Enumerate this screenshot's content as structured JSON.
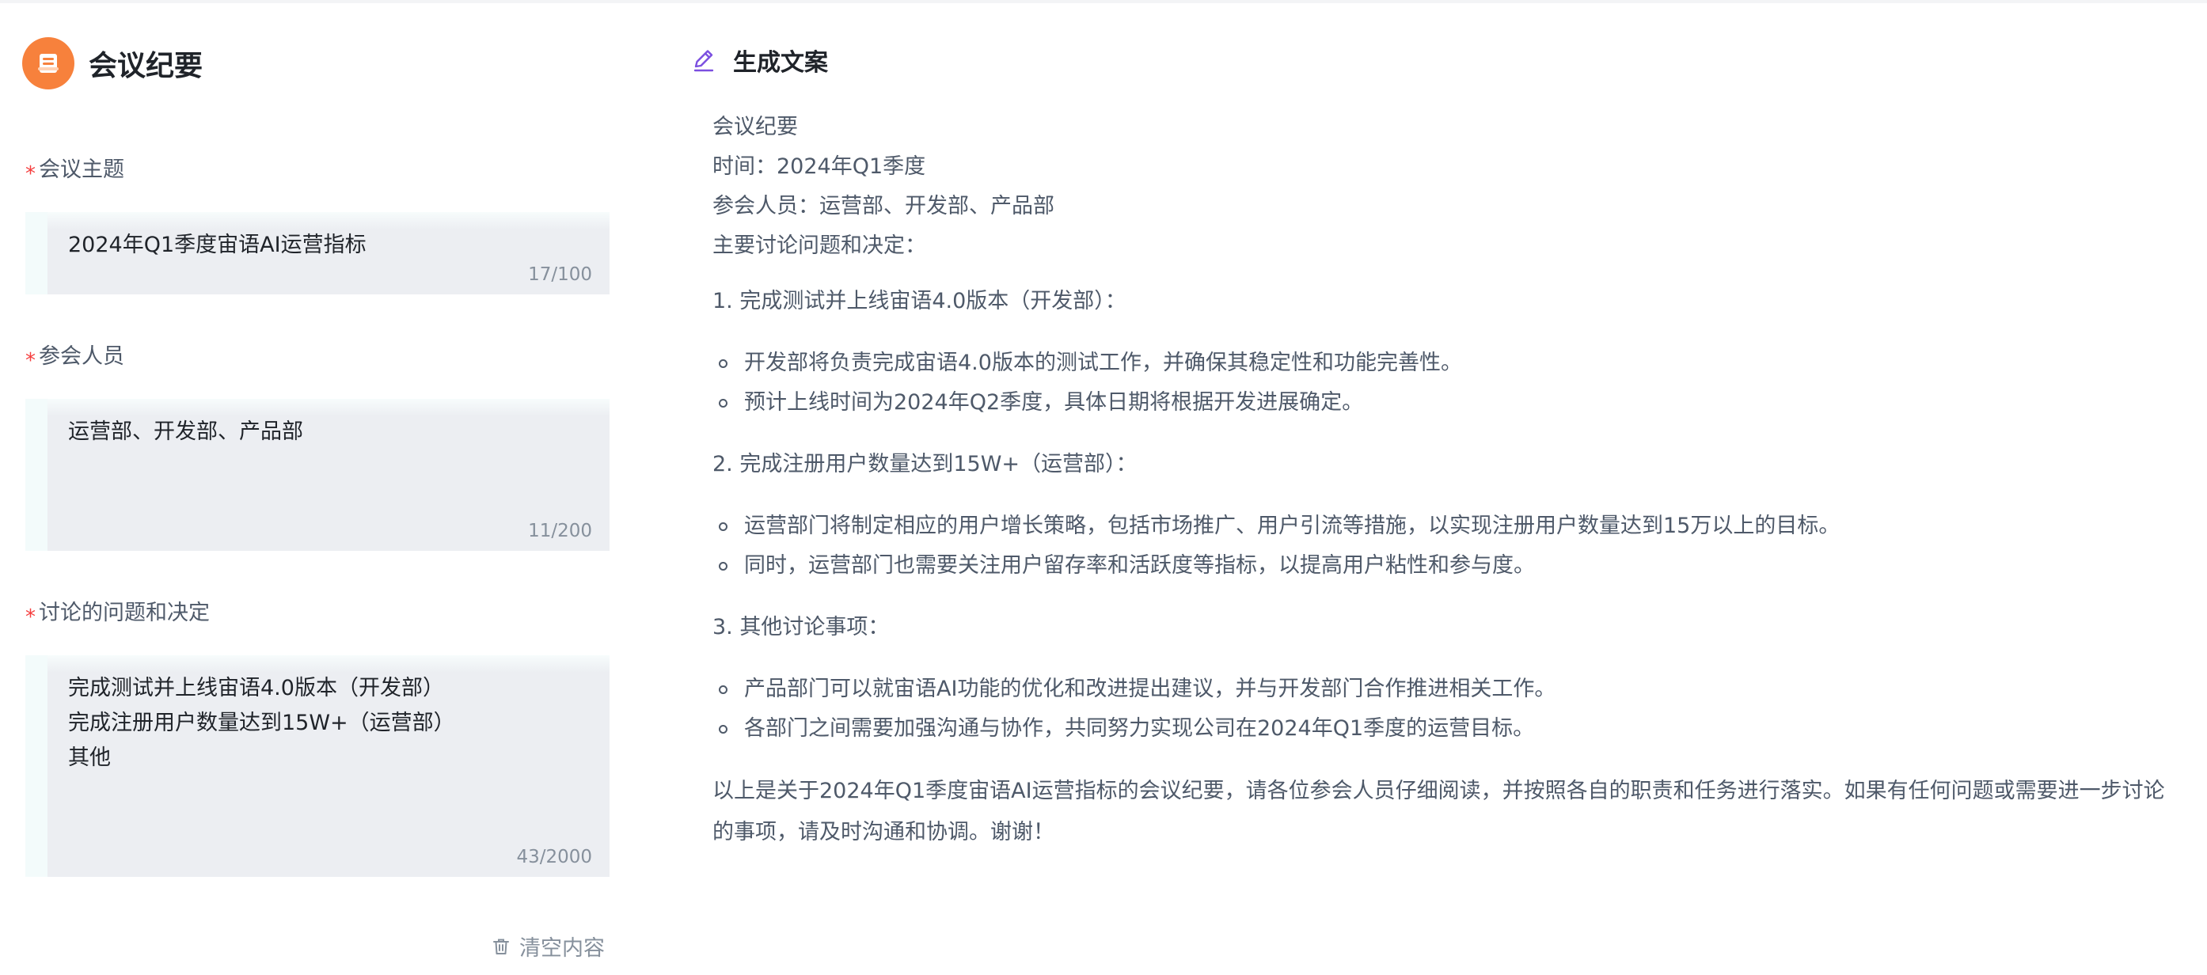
{
  "app": {
    "title": "会议纪要",
    "logo_icon": "document-icon",
    "accent_color": "#f7813c"
  },
  "form": {
    "fields": [
      {
        "label": "会议主题",
        "required": true,
        "value_lines": [
          "2024年Q1季度宙语AI运营指标"
        ],
        "count": "17/100"
      },
      {
        "label": "参会人员",
        "required": true,
        "value_lines": [
          "运营部、开发部、产品部"
        ],
        "count": "11/200"
      },
      {
        "label": "讨论的问题和决定",
        "required": true,
        "value_lines": [
          "完成测试并上线宙语4.0版本（开发部）",
          "完成注册用户数量达到15W+（运营部）",
          "其他"
        ],
        "count": "43/2000"
      }
    ],
    "required_mark": "*",
    "clear_label": "清空内容"
  },
  "output": {
    "title": "生成文案",
    "header_lines": [
      "会议纪要",
      "时间：2024年Q1季度",
      "参会人员：运营部、开发部、产品部",
      "主要讨论问题和决定："
    ],
    "sections": [
      {
        "heading": "1. 完成测试并上线宙语4.0版本（开发部）：",
        "bullets": [
          "开发部将负责完成宙语4.0版本的测试工作，并确保其稳定性和功能完善性。",
          "预计上线时间为2024年Q2季度，具体日期将根据开发进展确定。"
        ]
      },
      {
        "heading": "2. 完成注册用户数量达到15W+（运营部）：",
        "bullets": [
          "运营部门将制定相应的用户增长策略，包括市场推广、用户引流等措施，以实现注册用户数量达到15万以上的目标。",
          "同时，运营部门也需要关注用户留存率和活跃度等指标，以提高用户粘性和参与度。"
        ]
      },
      {
        "heading": "3. 其他讨论事项：",
        "bullets": [
          "产品部门可以就宙语AI功能的优化和改进提出建议，并与开发部门合作推进相关工作。",
          "各部门之间需要加强沟通与协作，共同努力实现公司在2024年Q1季度的运营目标。"
        ]
      }
    ],
    "summary": "以上是关于2024年Q1季度宙语AI运营指标的会议纪要，请各位参会人员仔细阅读，并按照各自的职责和任务进行落实。如果有任何问题或需要进一步讨论的事项，请及时沟通和协调。谢谢！"
  }
}
